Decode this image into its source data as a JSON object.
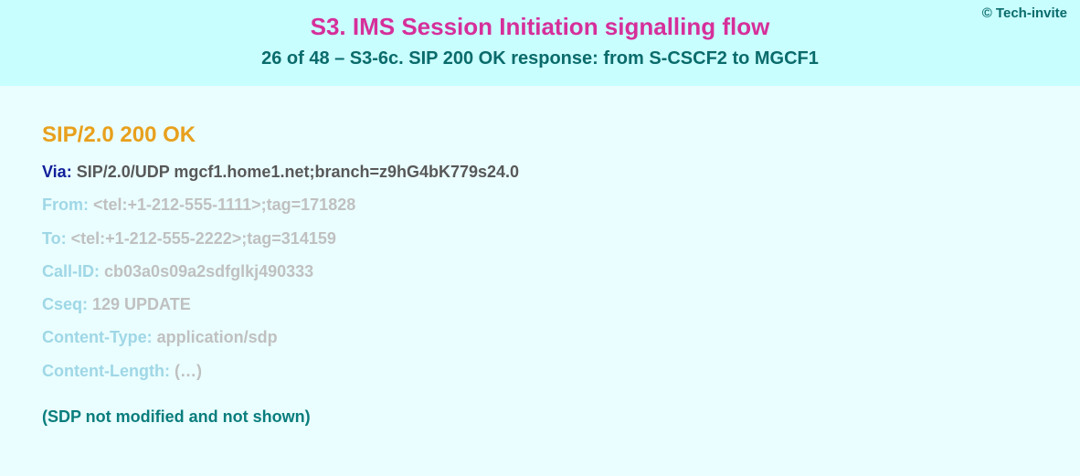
{
  "copyright": "© Tech-invite",
  "title": "S3. IMS Session Initiation signalling flow",
  "subtitle": "26 of 48 – S3-6c. SIP 200 OK response: from S-CSCF2 to MGCF1",
  "status_line": "SIP/2.0 200 OK",
  "headers": [
    {
      "name": "Via",
      "value": "SIP/2.0/UDP mgcf1.home1.net;branch=z9hG4bK779s24.0",
      "strong": true
    },
    {
      "name": "From",
      "value": "<tel:+1-212-555-1111>;tag=171828",
      "strong": false
    },
    {
      "name": "To",
      "value": "<tel:+1-212-555-2222>;tag=314159",
      "strong": false
    },
    {
      "name": "Call-ID",
      "value": "cb03a0s09a2sdfglkj490333",
      "strong": false
    },
    {
      "name": "Cseq",
      "value": "129 UPDATE",
      "strong": false
    },
    {
      "name": "Content-Type",
      "value": "application/sdp",
      "strong": false
    },
    {
      "name": "Content-Length",
      "value": "(…)",
      "strong": false
    }
  ],
  "sdp_note": "(SDP not modified and not shown)"
}
